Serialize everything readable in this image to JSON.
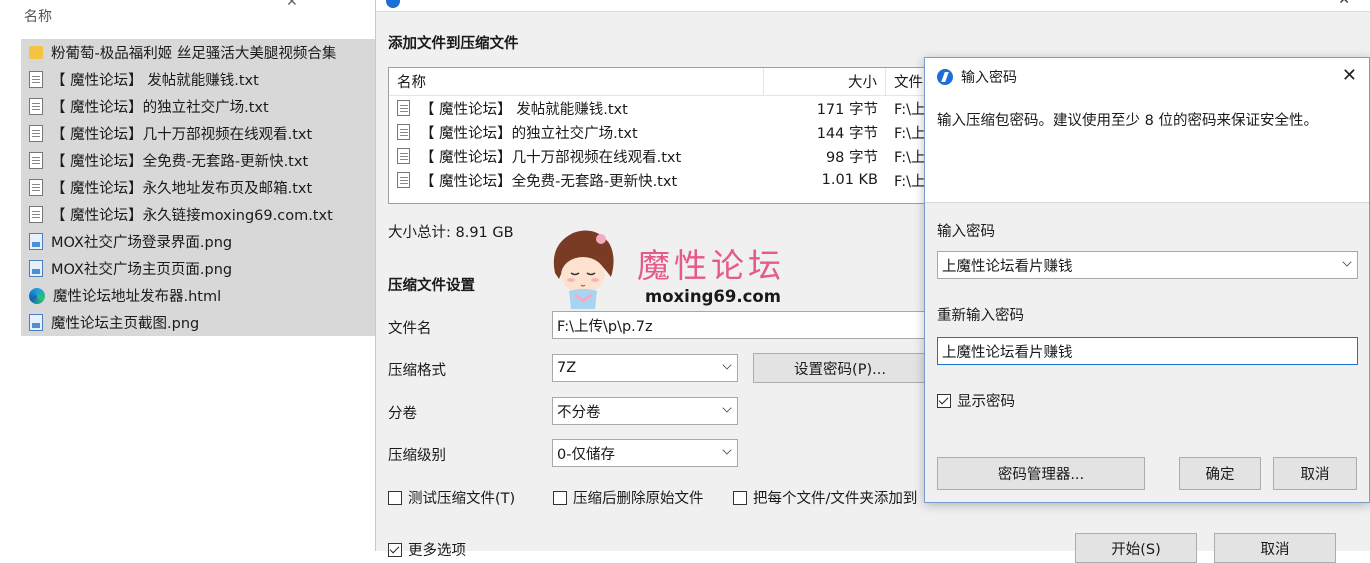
{
  "explorer": {
    "column_header": "名称",
    "files": [
      {
        "icon": "folder-icon",
        "name": "粉葡萄-极品福利姬 丝足骚活大美腿视频合集"
      },
      {
        "icon": "txt-file-icon",
        "name": "【 魔性论坛】 发帖就能赚钱.txt"
      },
      {
        "icon": "txt-file-icon",
        "name": "【 魔性论坛】的独立社交广场.txt"
      },
      {
        "icon": "txt-file-icon",
        "name": "【 魔性论坛】几十万部视频在线观看.txt"
      },
      {
        "icon": "txt-file-icon",
        "name": "【 魔性论坛】全免费-无套路-更新快.txt"
      },
      {
        "icon": "txt-file-icon",
        "name": "【 魔性论坛】永久地址发布页及邮箱.txt"
      },
      {
        "icon": "txt-file-icon",
        "name": "【 魔性论坛】永久链接moxing69.com.txt"
      },
      {
        "icon": "png-file-icon",
        "name": "MOX社交广场登录界面.png"
      },
      {
        "icon": "png-file-icon",
        "name": "MOX社交广场主页页面.png"
      },
      {
        "icon": "edge-html-icon",
        "name": "魔性论坛地址发布器.html"
      },
      {
        "icon": "png-file-icon",
        "name": "魔性论坛主页截图.png"
      }
    ]
  },
  "compress": {
    "add_files_title": "添加文件到压缩文件",
    "list_headers": {
      "name": "名称",
      "size": "大小",
      "path": "文件"
    },
    "list_rows": [
      {
        "name": "【 魔性论坛】 发帖就能赚钱.txt",
        "size": "171 字节",
        "path": "F:\\上"
      },
      {
        "name": "【 魔性论坛】的独立社交广场.txt",
        "size": "144 字节",
        "path": "F:\\上"
      },
      {
        "name": "【 魔性论坛】几十万部视频在线观看.txt",
        "size": "98 字节",
        "path": "F:\\上"
      },
      {
        "name": "【 魔性论坛】全免费-无套路-更新快.txt",
        "size": "1.01 KB",
        "path": "F:\\上"
      }
    ],
    "total_size": "大小总计: 8.91 GB",
    "settings_title": "压缩文件设置",
    "filename_label": "文件名",
    "filename_value": "F:\\上传\\p\\p.7z",
    "format_label": "压缩格式",
    "format_value": "7Z",
    "set_password_button": "设置密码(P)...",
    "split_label": "分卷",
    "split_value": "不分卷",
    "level_label": "压缩级别",
    "level_value": "0-仅储存",
    "test_check": "测试压缩文件(T)",
    "delete_check": "压缩后删除原始文件",
    "each_check": "把每个文件/文件夹添加到",
    "more_options": "更多选项",
    "start_button": "开始(S)",
    "cancel_button": "取消"
  },
  "watermark": {
    "text_cn": "魔性论坛",
    "url": "moxing69.com"
  },
  "password_dialog": {
    "title": "输入密码",
    "description": "输入压缩包密码。建议使用至少 8 位的密码来保证安全性。",
    "enter_label": "输入密码",
    "enter_value": "上魔性论坛看片赚钱",
    "reenter_label": "重新输入密码",
    "reenter_value": "上魔性论坛看片赚钱",
    "show_password": "显示密码",
    "manager_button": "密码管理器...",
    "ok_button": "确定",
    "cancel_button": "取消"
  }
}
